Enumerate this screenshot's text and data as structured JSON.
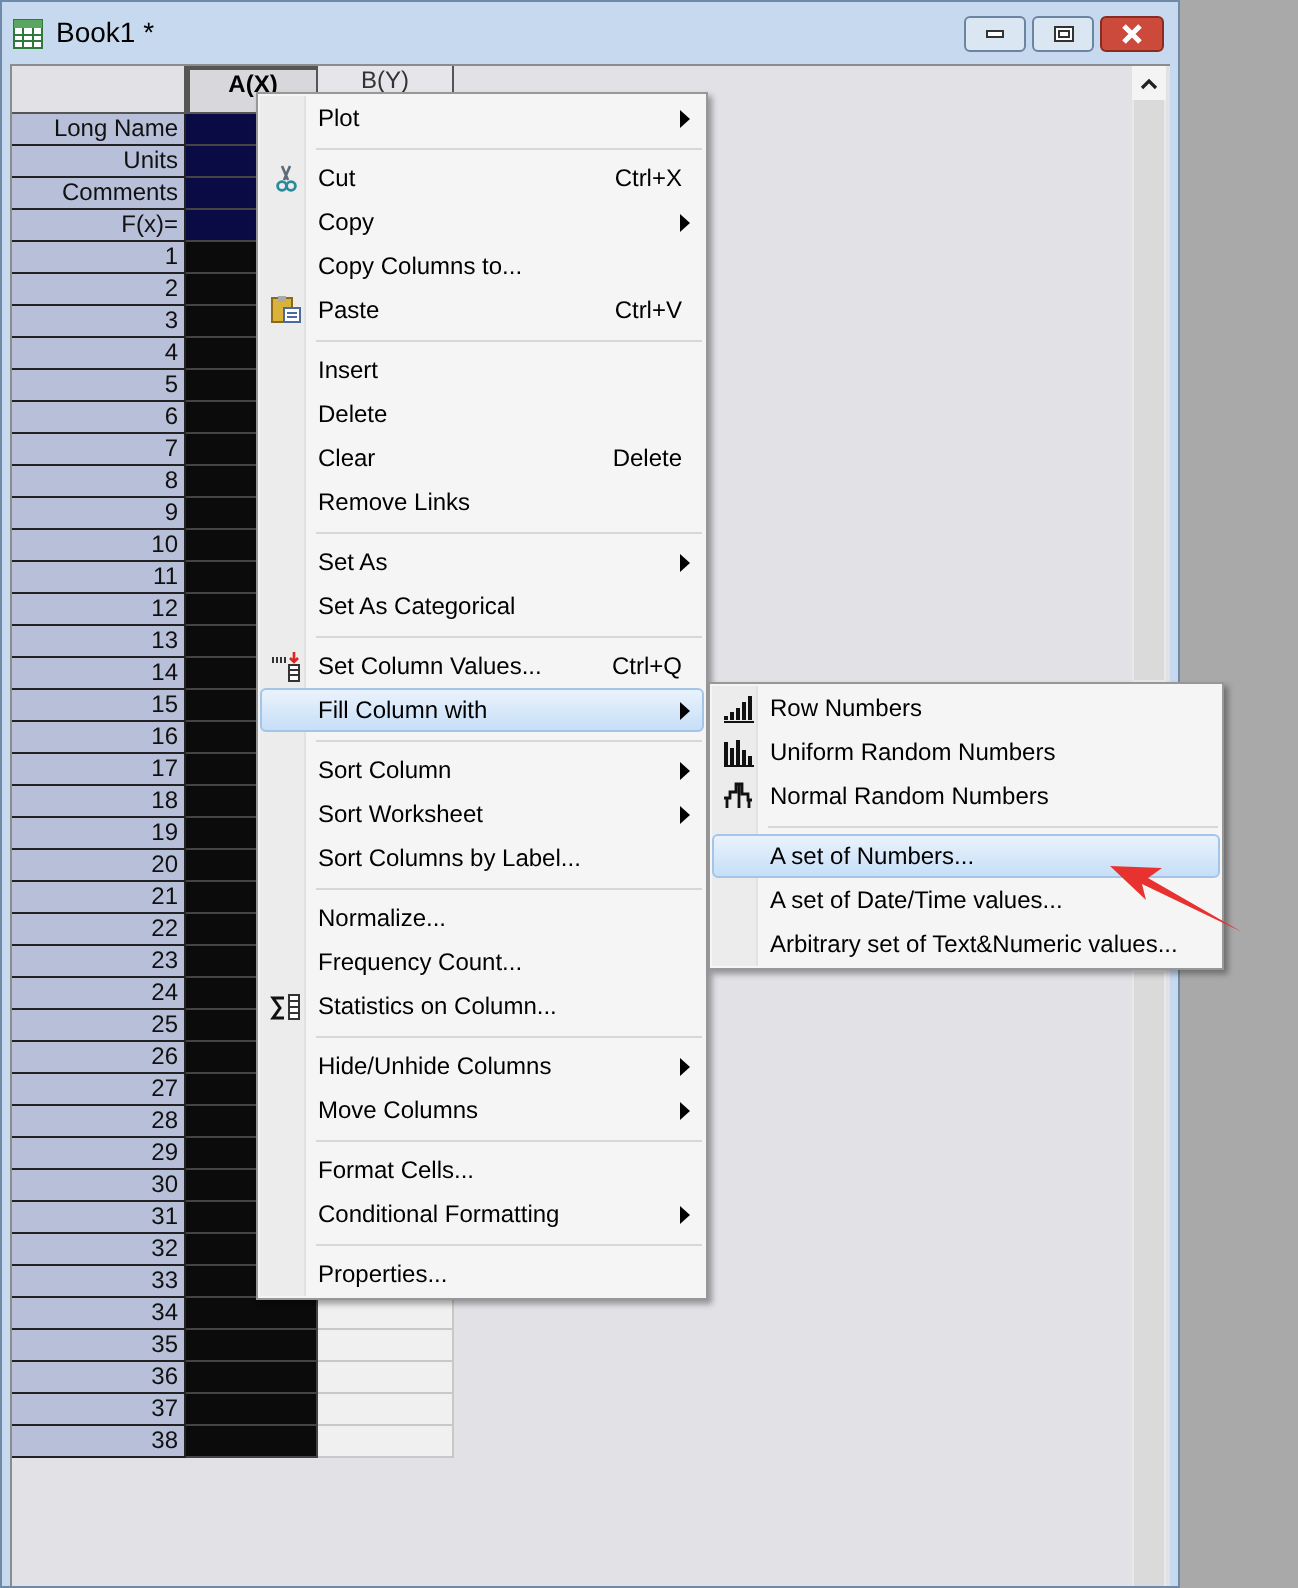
{
  "window": {
    "title": "Book1 *"
  },
  "worksheet": {
    "columns": [
      {
        "label": "A(X)",
        "selected": true
      },
      {
        "label": "B(Y)",
        "selected": false
      }
    ],
    "label_rows": [
      "Long Name",
      "Units",
      "Comments",
      "F(x)="
    ],
    "rows": [
      "1",
      "2",
      "3",
      "4",
      "5",
      "6",
      "7",
      "8",
      "9",
      "10",
      "11",
      "12",
      "13",
      "14",
      "15",
      "16",
      "17",
      "18",
      "19",
      "20",
      "21",
      "22",
      "23",
      "24",
      "25",
      "26",
      "27",
      "28",
      "29",
      "30",
      "31",
      "32",
      "33",
      "34",
      "35",
      "36",
      "37",
      "38"
    ]
  },
  "context_menu": {
    "items": [
      {
        "kind": "item",
        "label": "Plot",
        "submenu": true,
        "selected": false
      },
      {
        "kind": "separator"
      },
      {
        "kind": "item",
        "label": "Cut",
        "shortcut": "Ctrl+X",
        "selected": false
      },
      {
        "kind": "item",
        "label": "Copy",
        "submenu": true,
        "selected": false
      },
      {
        "kind": "item",
        "label": "Copy Columns to...",
        "selected": false
      },
      {
        "kind": "item",
        "label": "Paste",
        "shortcut": "Ctrl+V",
        "selected": false
      },
      {
        "kind": "separator"
      },
      {
        "kind": "item",
        "label": "Insert",
        "selected": false
      },
      {
        "kind": "item",
        "label": "Delete",
        "selected": false
      },
      {
        "kind": "item",
        "label": "Clear",
        "shortcut": "Delete",
        "selected": false
      },
      {
        "kind": "item",
        "label": "Remove Links",
        "selected": false
      },
      {
        "kind": "separator"
      },
      {
        "kind": "item",
        "label": "Set As",
        "submenu": true,
        "selected": false
      },
      {
        "kind": "item",
        "label": "Set As Categorical",
        "selected": false
      },
      {
        "kind": "separator"
      },
      {
        "kind": "item",
        "label": "Set Column Values...",
        "shortcut": "Ctrl+Q",
        "selected": false
      },
      {
        "kind": "item",
        "label": "Fill Column with",
        "submenu": true,
        "selected": true
      },
      {
        "kind": "separator"
      },
      {
        "kind": "item",
        "label": "Sort Column",
        "submenu": true,
        "selected": false
      },
      {
        "kind": "item",
        "label": "Sort Worksheet",
        "submenu": true,
        "selected": false
      },
      {
        "kind": "item",
        "label": "Sort Columns by Label...",
        "selected": false
      },
      {
        "kind": "separator"
      },
      {
        "kind": "item",
        "label": "Normalize...",
        "selected": false
      },
      {
        "kind": "item",
        "label": "Frequency Count...",
        "selected": false
      },
      {
        "kind": "item",
        "label": "Statistics on Column...",
        "selected": false
      },
      {
        "kind": "separator"
      },
      {
        "kind": "item",
        "label": "Hide/Unhide Columns",
        "submenu": true,
        "selected": false
      },
      {
        "kind": "item",
        "label": "Move Columns",
        "submenu": true,
        "selected": false
      },
      {
        "kind": "separator"
      },
      {
        "kind": "item",
        "label": "Format Cells...",
        "selected": false
      },
      {
        "kind": "item",
        "label": "Conditional Formatting",
        "submenu": true,
        "selected": false
      },
      {
        "kind": "separator"
      },
      {
        "kind": "item",
        "label": "Properties...",
        "selected": false
      }
    ]
  },
  "submenu": {
    "items": [
      {
        "kind": "item",
        "label": "Row Numbers",
        "selected": false
      },
      {
        "kind": "item",
        "label": "Uniform Random Numbers",
        "selected": false
      },
      {
        "kind": "item",
        "label": "Normal Random Numbers",
        "selected": false
      },
      {
        "kind": "separator"
      },
      {
        "kind": "item",
        "label": "A set of Numbers...",
        "selected": true
      },
      {
        "kind": "item",
        "label": "A set of Date/Time values...",
        "selected": false
      },
      {
        "kind": "item",
        "label": "Arbitrary set of Text&Numeric values...",
        "selected": false
      }
    ]
  }
}
